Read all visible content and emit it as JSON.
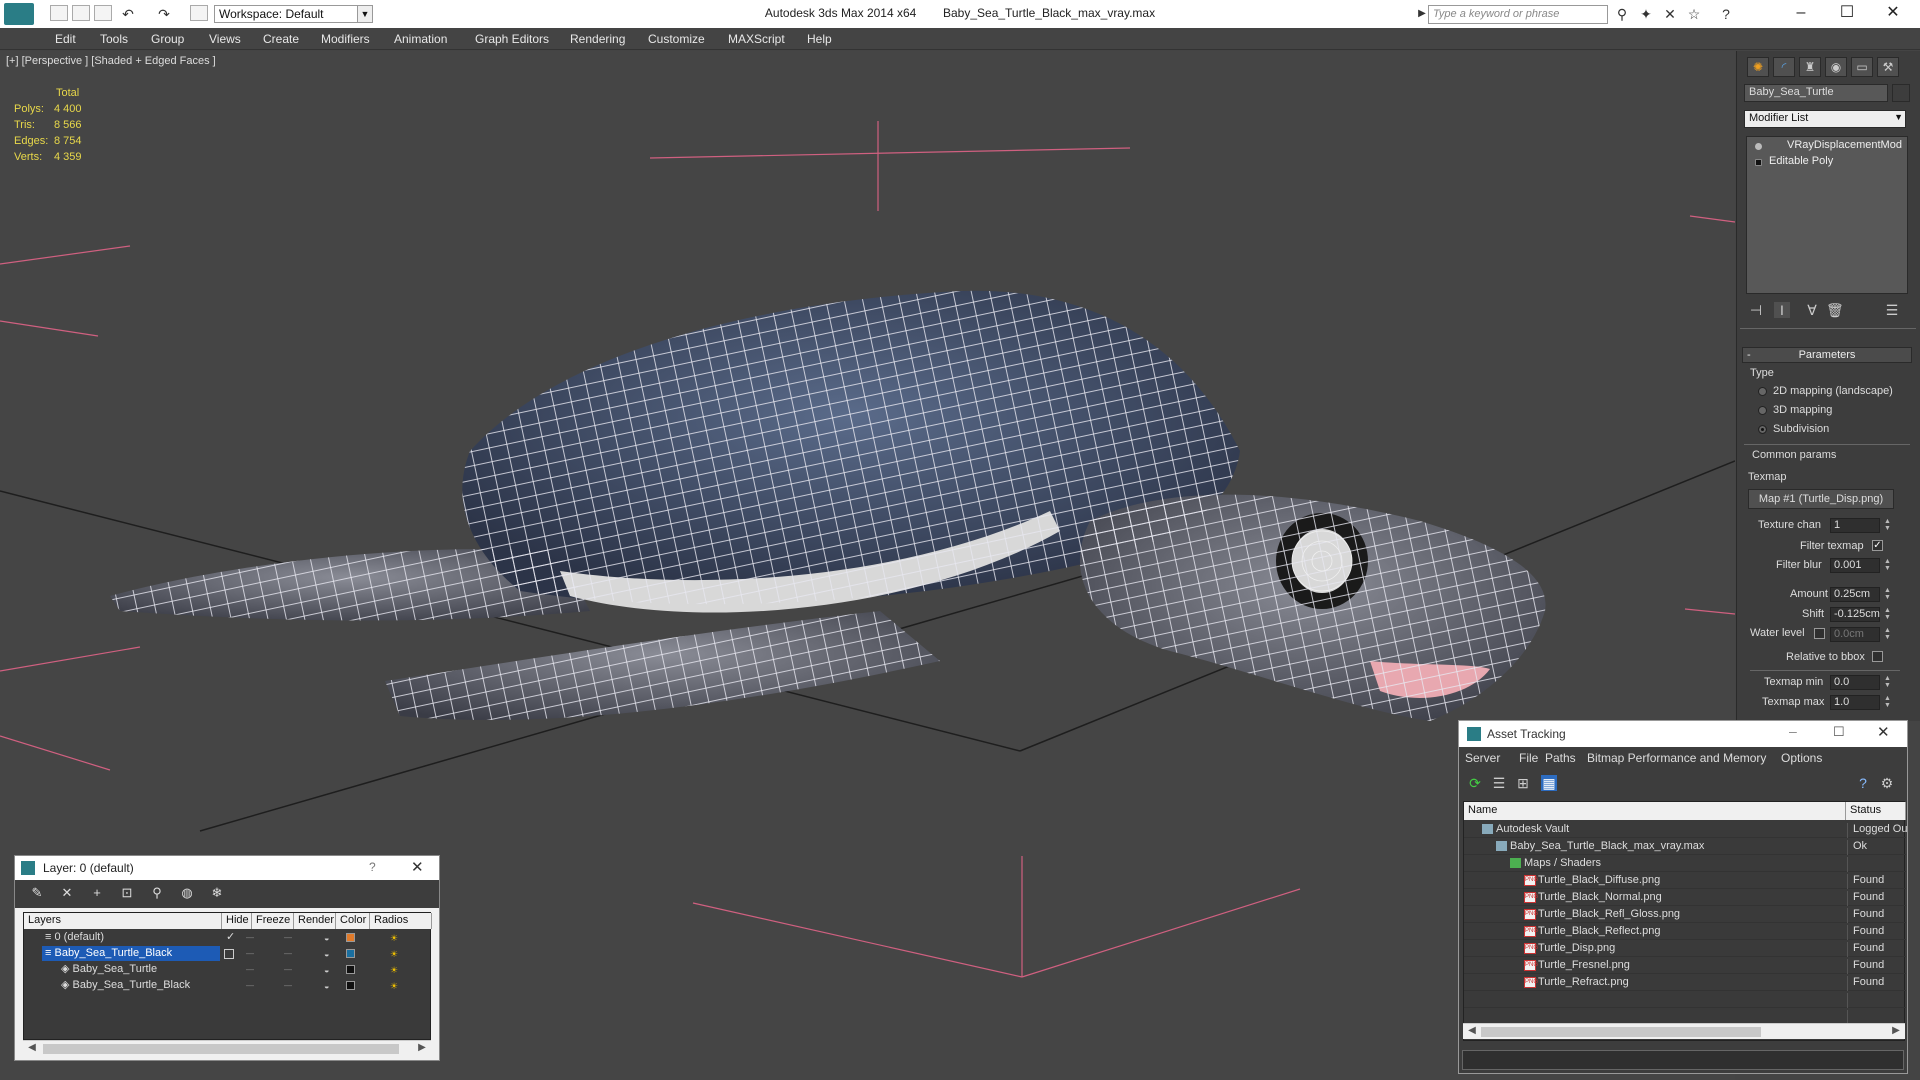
{
  "titlebar": {
    "workspace": "Workspace: Default",
    "app_title": "Autodesk 3ds Max  2014 x64",
    "file_name": "Baby_Sea_Turtle_Black_max_vray.max",
    "search_placeholder": "Type a keyword or phrase"
  },
  "menu": [
    "Edit",
    "Tools",
    "Group",
    "Views",
    "Create",
    "Modifiers",
    "Animation",
    "Graph Editors",
    "Rendering",
    "Customize",
    "MAXScript",
    "Help"
  ],
  "viewport": {
    "label": "[+] [Perspective ] [Shaded + Edged Faces ]",
    "stats_header": "Total",
    "stats": [
      {
        "k": "Polys:",
        "v": "4 400"
      },
      {
        "k": "Tris:",
        "v": "8 566"
      },
      {
        "k": "Edges:",
        "v": "8 754"
      },
      {
        "k": "Verts:",
        "v": "4 359"
      }
    ]
  },
  "command_panel": {
    "object_name": "Baby_Sea_Turtle",
    "modifier_list": "Modifier List",
    "stack": [
      "VRayDisplacementMod",
      "Editable Poly"
    ],
    "rollout": "Parameters",
    "type_label": "Type",
    "types": [
      "2D mapping (landscape)",
      "3D mapping",
      "Subdivision"
    ],
    "selected_type": "Subdivision",
    "common_params": "Common params",
    "texmap_label": "Texmap",
    "texmap_button": "Map #1 (Turtle_Disp.png)",
    "texture_chan_label": "Texture chan",
    "texture_chan": "1",
    "filter_texmap_label": "Filter texmap",
    "filter_texmap_checked": "✓",
    "filter_blur_label": "Filter blur",
    "filter_blur": "0.001",
    "amount_label": "Amount",
    "amount": "0.25cm",
    "shift_label": "Shift",
    "shift": "-0.125cm",
    "water_level_label": "Water level",
    "water_level": "0.0cm",
    "relative_bbox_label": "Relative to bbox",
    "texmap_min_label": "Texmap min",
    "texmap_min": "0.0",
    "texmap_max_label": "Texmap max",
    "texmap_max": "1.0"
  },
  "layer_dialog": {
    "title": "Layer: 0 (default)",
    "help": "?",
    "columns": [
      "Layers",
      "Hide",
      "Freeze",
      "Render",
      "Color",
      "Radios"
    ],
    "rows": [
      {
        "name": "0 (default)",
        "color": "#e07a2a"
      },
      {
        "name": "Baby_Sea_Turtle_Black",
        "color": "#1a6fa0"
      },
      {
        "name": "Baby_Sea_Turtle",
        "color": "#111111"
      },
      {
        "name": "Baby_Sea_Turtle_Black",
        "color": "#111111"
      }
    ],
    "checkmark": "✓"
  },
  "asset_tracking": {
    "title": "Asset Tracking",
    "menu": [
      "Server",
      "File",
      "Paths",
      "Bitmap Performance and Memory",
      "Options"
    ],
    "columns": [
      "Name",
      "Status"
    ],
    "rows": [
      {
        "name": "Autodesk Vault",
        "status": "Logged Out",
        "indent": 0
      },
      {
        "name": "Baby_Sea_Turtle_Black_max_vray.max",
        "status": "Ok",
        "indent": 1
      },
      {
        "name": "Maps / Shaders",
        "status": "",
        "indent": 2
      },
      {
        "name": "Turtle_Black_Diffuse.png",
        "status": "Found",
        "indent": 3
      },
      {
        "name": "Turtle_Black_Normal.png",
        "status": "Found",
        "indent": 3
      },
      {
        "name": "Turtle_Black_Refl_Gloss.png",
        "status": "Found",
        "indent": 3
      },
      {
        "name": "Turtle_Black_Reflect.png",
        "status": "Found",
        "indent": 3
      },
      {
        "name": "Turtle_Disp.png",
        "status": "Found",
        "indent": 3
      },
      {
        "name": "Turtle_Fresnel.png",
        "status": "Found",
        "indent": 3
      },
      {
        "name": "Turtle_Refract.png",
        "status": "Found",
        "indent": 3
      }
    ],
    "png_tag": "PNG"
  }
}
